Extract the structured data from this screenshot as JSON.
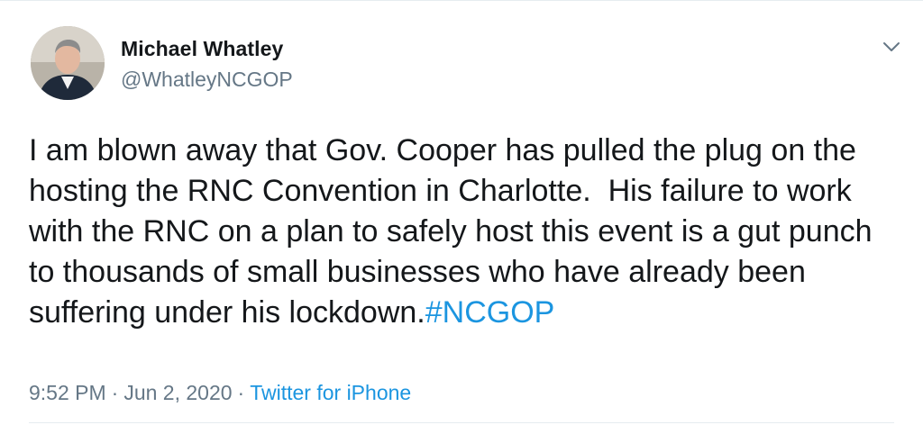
{
  "author": {
    "name": "Michael Whatley",
    "handle": "@WhatleyNCGOP"
  },
  "tweet": {
    "text": "I am blown away that Gov. Cooper has pulled the plug on the hosting the RNC Convention in Charlotte.  His failure to work with the RNC on a plan to safely host this event is a gut punch to thousands of small businesses who have already been suffering under his lockdown.",
    "hashtag": "#NCGOP"
  },
  "meta": {
    "time": "9:52 PM",
    "separator": "·",
    "date": "Jun 2, 2020",
    "source": "Twitter for iPhone"
  },
  "icons": {
    "menu": "chevron-down-icon",
    "avatar": "avatar"
  },
  "colors": {
    "text": "#14171a",
    "secondary": "#657786",
    "link": "#1b95e0",
    "border": "#e6ecf0"
  }
}
